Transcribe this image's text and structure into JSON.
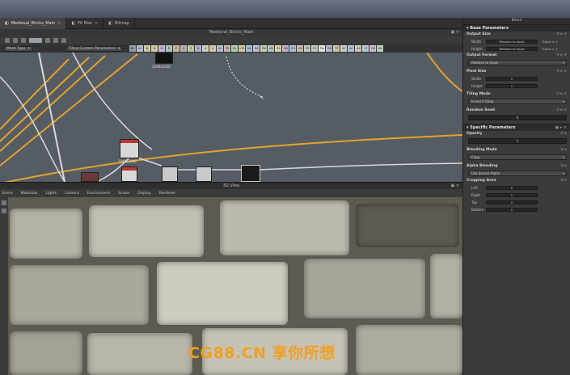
{
  "tabs": [
    {
      "label": "Medieval_Bricks_Main",
      "active": true
    },
    {
      "label": "Fit Max",
      "active": false
    },
    {
      "label": "Bitmap",
      "active": false
    }
  ],
  "graph": {
    "title": "Medieval_Bricks_Main",
    "mesh_type_label": "Mesh Type",
    "tiling_label": "Tiling Custom Parameters",
    "channel_chips": [
      "BC",
      "AO",
      "N",
      "H",
      "M",
      "R",
      "E",
      "O",
      "S",
      "D",
      "G",
      "A",
      "SC",
      "TR",
      "GL",
      "IOR",
      "ML",
      "BS",
      "PM",
      "AN",
      "SS",
      "SD",
      "CO",
      "CN",
      "FE",
      "FC",
      "Pre",
      "GR",
      "TF",
      "SC",
      "AC",
      "AS",
      "LT",
      "GR",
      "AN"
    ],
    "node_size_label": "2048x2048",
    "node_size_label_2": "2048x2048"
  },
  "view3d": {
    "title": "3D View",
    "menu": [
      "Scene",
      "Materials",
      "Lights",
      "Camera",
      "Environment",
      "Scene",
      "Display",
      "Renderer"
    ]
  },
  "watermark": "CG88.CN 享你所想",
  "panel": {
    "title": "Blend",
    "base_params": "Base Parameters",
    "output_size": "Output Size",
    "width_label": "Width",
    "height_label": "Height",
    "relative_to_input": "Relative to Input",
    "relative_aux_1": "Equal × 1",
    "relative_aux_2": "Equal × 1",
    "output_format": "Output Format",
    "output_format_value": "Relative to Input",
    "pixel_size": "Pixel Size",
    "tiling_mode": "Tiling Mode",
    "tiling_value": "H and V tiling",
    "random_seed": "Random Seed",
    "random_seed_value": "0",
    "specific_params": "Specific Parameters",
    "opacity": "Opacity",
    "opacity_value": "1",
    "blending_mode": "Blending Mode",
    "blending_value": "Copy",
    "alpha_blending": "Alpha Blending",
    "alpha_value": "Use Source Alpha",
    "cropping_area": "Cropping Area",
    "crop_rows": [
      {
        "key": "Left",
        "value": "0"
      },
      {
        "key": "Right",
        "value": "1"
      },
      {
        "key": "Top",
        "value": "0"
      },
      {
        "key": "Bottom",
        "value": "1"
      }
    ]
  }
}
